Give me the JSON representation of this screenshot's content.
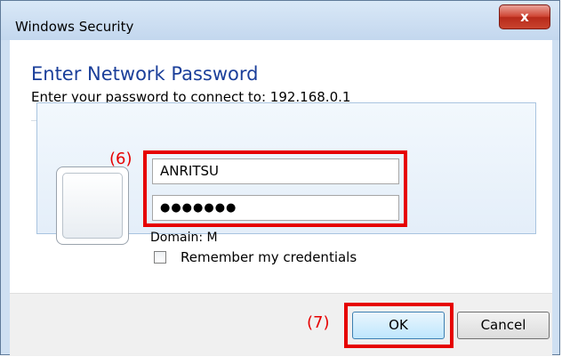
{
  "window": {
    "title": "Windows Security",
    "close_label": "x"
  },
  "dialog": {
    "heading": "Enter Network Password",
    "subtext": "Enter your password to connect to: 192.168.0.1"
  },
  "credentials": {
    "username_value": "ANRITSU",
    "password_value": "●●●●●●●",
    "domain_text": "Domain: M",
    "remember_label": "Remember my credentials",
    "remember_checked": false
  },
  "annotations": {
    "credentials_marker": "(6)",
    "ok_marker": "(7)",
    "highlight_color": "#e60000"
  },
  "buttons": {
    "ok": "OK",
    "cancel": "Cancel"
  }
}
